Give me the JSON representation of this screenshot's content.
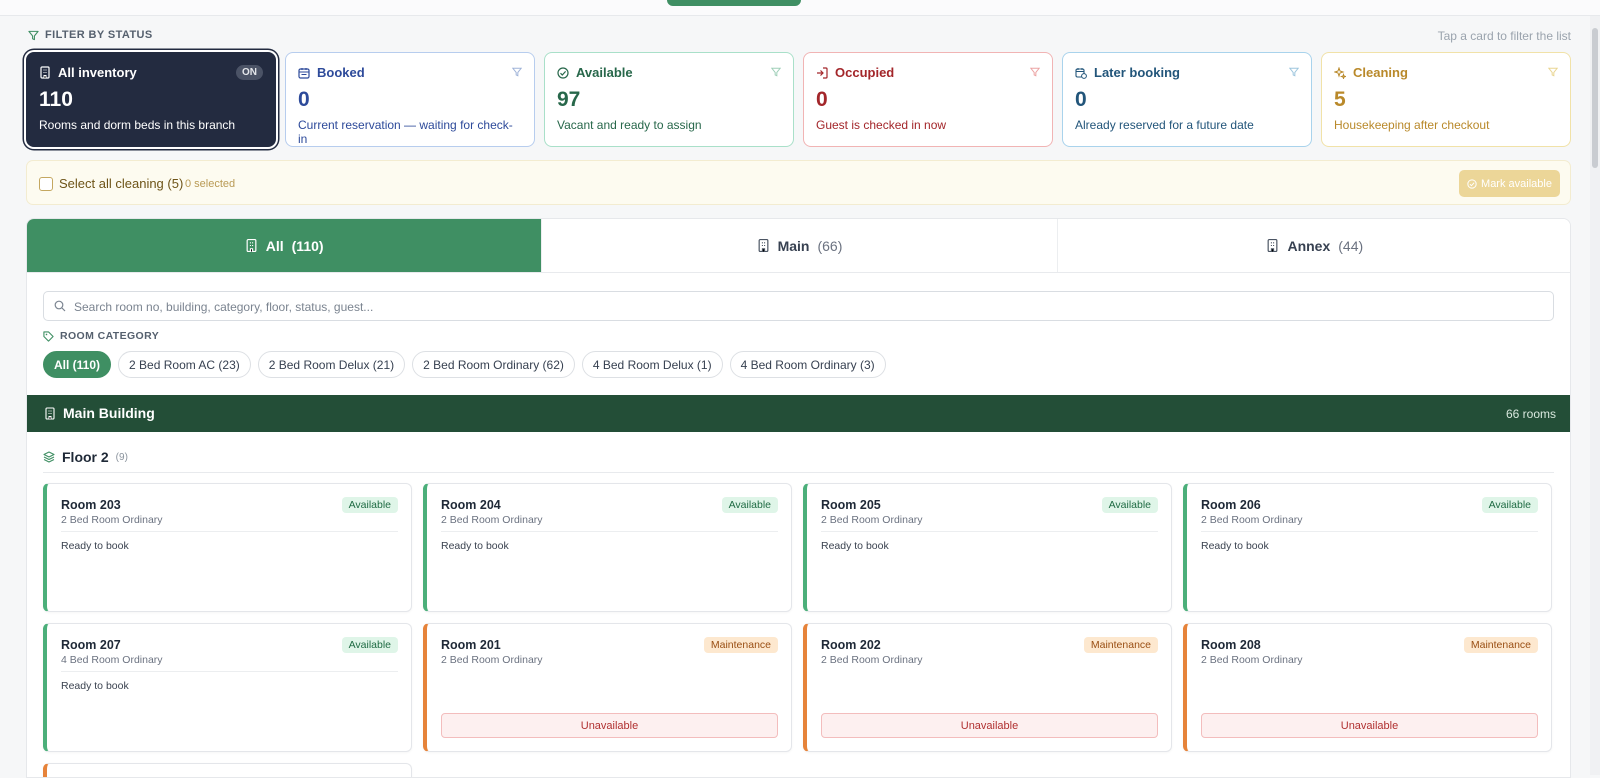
{
  "filter": {
    "heading": "FILTER BY STATUS",
    "hint": "Tap a card to filter the list",
    "cards": [
      {
        "label": "All inventory",
        "value": "110",
        "desc": "Rooms and dorm beds in this branch",
        "badge": "ON"
      },
      {
        "label": "Booked",
        "value": "0",
        "desc": "Current reservation — waiting for check-in"
      },
      {
        "label": "Available",
        "value": "97",
        "desc": "Vacant and ready to assign"
      },
      {
        "label": "Occupied",
        "value": "0",
        "desc": "Guest is checked in now"
      },
      {
        "label": "Later booking",
        "value": "0",
        "desc": "Already reserved for a future date"
      },
      {
        "label": "Cleaning",
        "value": "5",
        "desc": "Housekeeping after checkout"
      }
    ]
  },
  "cleaning": {
    "select_all": "Select all cleaning (5)",
    "selected": "0 selected",
    "mark_button": "Mark available"
  },
  "tabs": [
    {
      "label": "All",
      "count": "(110)"
    },
    {
      "label": "Main",
      "count": "(66)"
    },
    {
      "label": "Annex",
      "count": "(44)"
    }
  ],
  "search": {
    "placeholder": "Search room no, building, category, floor, status, guest..."
  },
  "category": {
    "heading": "ROOM CATEGORY",
    "chips": [
      "All (110)",
      "2 Bed Room AC (23)",
      "2 Bed Room Delux (21)",
      "2 Bed Room Ordinary (62)",
      "4 Bed Room Delux (1)",
      "4 Bed Room Ordinary (3)"
    ]
  },
  "building": {
    "name": "Main Building",
    "count": "66 rooms"
  },
  "floor": {
    "name": "Floor 2",
    "count": "(9)"
  },
  "rooms": [
    {
      "title": "Room 203",
      "type": "2 Bed Room Ordinary",
      "status": "Available",
      "note": "Ready to book"
    },
    {
      "title": "Room 204",
      "type": "2 Bed Room Ordinary",
      "status": "Available",
      "note": "Ready to book"
    },
    {
      "title": "Room 205",
      "type": "2 Bed Room Ordinary",
      "status": "Available",
      "note": "Ready to book"
    },
    {
      "title": "Room 206",
      "type": "2 Bed Room Ordinary",
      "status": "Available",
      "note": "Ready to book"
    },
    {
      "title": "Room 207",
      "type": "4 Bed Room Ordinary",
      "status": "Available",
      "note": "Ready to book"
    },
    {
      "title": "Room 201",
      "type": "2 Bed Room Ordinary",
      "status": "Maintenance",
      "note": "Unavailable"
    },
    {
      "title": "Room 202",
      "type": "2 Bed Room Ordinary",
      "status": "Maintenance",
      "note": "Unavailable"
    },
    {
      "title": "Room 208",
      "type": "2 Bed Room Ordinary",
      "status": "Maintenance",
      "note": "Unavailable"
    }
  ],
  "colors": {
    "primary": "#3f8f63",
    "dark_card": "#232b40",
    "building_bar": "#234e37",
    "available": "#4caf7a",
    "maintenance": "#e6833a"
  }
}
